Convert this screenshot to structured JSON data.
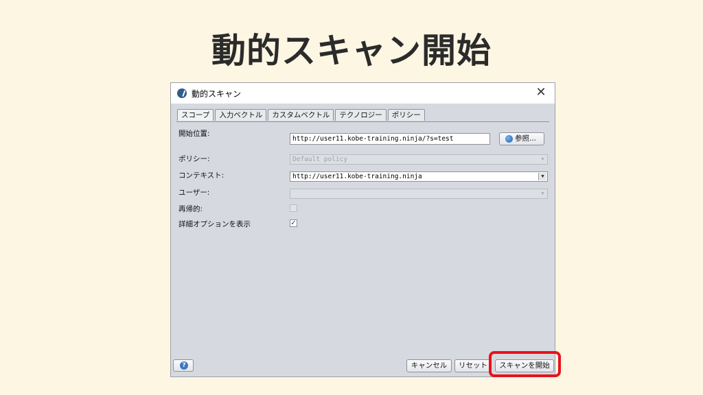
{
  "slide": {
    "title": "動的スキャン開始"
  },
  "window": {
    "title": "動的スキャン",
    "close_glyph": "✕"
  },
  "tabs": [
    {
      "label": "スコープ",
      "active": true
    },
    {
      "label": "入力ベクトル",
      "active": false
    },
    {
      "label": "カスタムベクトル",
      "active": false
    },
    {
      "label": "テクノロジー",
      "active": false
    },
    {
      "label": "ポリシー",
      "active": false
    }
  ],
  "form": {
    "start_point_label": "開始位置:",
    "start_point_value": "http://user11.kobe-training.ninja/?s=test",
    "browse_label": "参照...",
    "policy_label": "ポリシー:",
    "policy_value": "Default policy",
    "context_label": "コンテキスト:",
    "context_value": "http://user11.kobe-training.ninja",
    "user_label": "ユーザー:",
    "user_value": "",
    "recurse_label": "再帰的:",
    "recurse_checked": false,
    "advanced_label": "詳細オプションを表示",
    "advanced_checked": true,
    "check_glyph": "✓",
    "arrow_glyph": "▼"
  },
  "buttons": {
    "help_glyph": "?",
    "cancel": "キャンセル",
    "reset": "リセット",
    "start_scan": "スキャンを開始"
  },
  "colors": {
    "background": "#fdf6e3",
    "dialog": "#d6d9df",
    "highlight": "#e8121b"
  }
}
